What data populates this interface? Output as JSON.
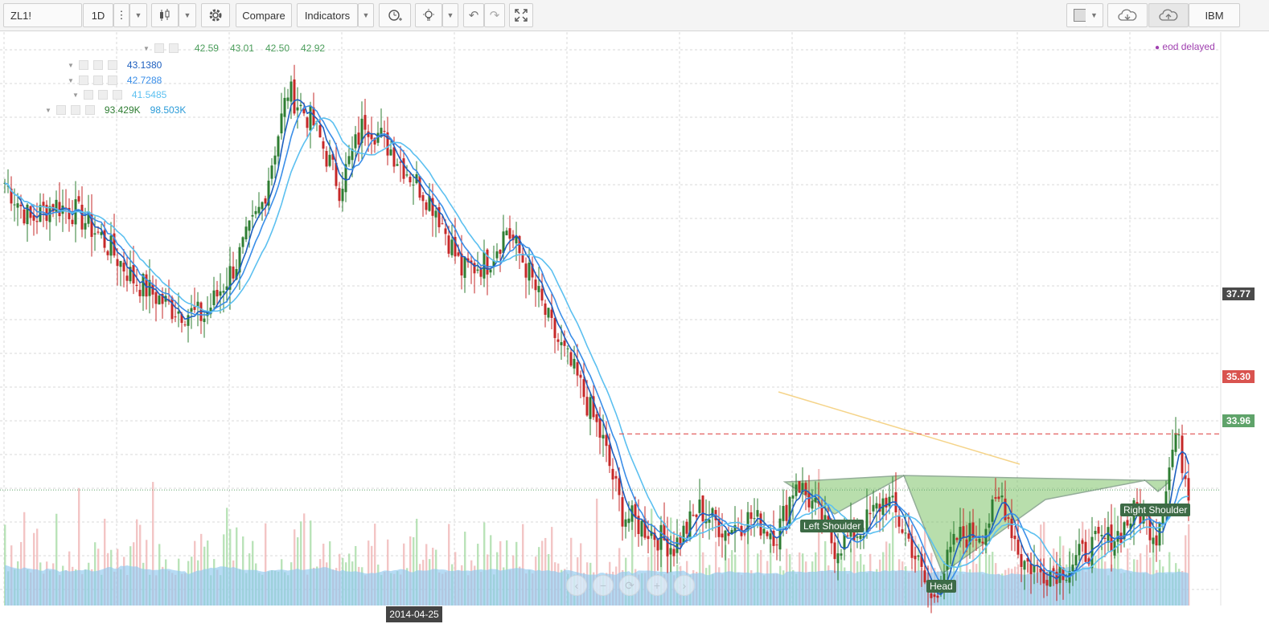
{
  "toolbar": {
    "symbol": "ZL1!",
    "interval": "1D",
    "compare_label": "Compare",
    "indicators_label": "Indicators",
    "account_label": "IBM",
    "icons": [
      "candles-icon",
      "gear-icon",
      "alarm-icon",
      "idea-bulb-icon",
      "undo-icon",
      "redo-icon",
      "fullscreen-icon",
      "color-swatch-icon",
      "cloud-load-icon",
      "cloud-save-icon"
    ]
  },
  "legend": {
    "ohlc": [
      "42.59",
      "43.01",
      "42.50",
      "42.92"
    ],
    "ma1": "43.1380",
    "ma2": "42.7288",
    "ma3": "41.5485",
    "volume": [
      "93.429K",
      "98.503K"
    ]
  },
  "eod_label": "eod delayed",
  "price_labels": {
    "p1": "37.77",
    "p2": "35.30",
    "p3": "33.96"
  },
  "date_label": "2014-04-25",
  "nav_buttons": [
    "‹",
    "−",
    "⟳",
    "+",
    "›"
  ],
  "annotations": {
    "left_shoulder": "Left Shoulder",
    "head": "Head",
    "right_shoulder": "Right Shoulder"
  },
  "colors": {
    "up": "#2e7d32",
    "down": "#c62828",
    "ma1": "#1e5fbf",
    "ma2": "#3a8ee8",
    "ma3": "#5cc0f0",
    "volume_area": "#8fc8ee",
    "pattern_fill": "#7fc46a",
    "resistance": "#e05050",
    "last_price": "#5fa36a"
  },
  "chart_data": {
    "type": "candlestick",
    "symbol": "ZL1!",
    "interval": "1D",
    "ylim": [
      31.2,
      44.9
    ],
    "close_keypoints": [
      [
        0,
        41.3
      ],
      [
        8,
        40.4
      ],
      [
        15,
        40.8
      ],
      [
        22,
        40.6
      ],
      [
        30,
        40.0
      ],
      [
        40,
        39.0
      ],
      [
        52,
        38.3
      ],
      [
        62,
        38.1
      ],
      [
        72,
        39.4
      ],
      [
        80,
        40.8
      ],
      [
        88,
        43.5
      ],
      [
        96,
        42.7
      ],
      [
        104,
        41.2
      ],
      [
        112,
        42.8
      ],
      [
        118,
        42.3
      ],
      [
        126,
        41.5
      ],
      [
        134,
        40.7
      ],
      [
        142,
        39.2
      ],
      [
        150,
        39.4
      ],
      [
        156,
        40.2
      ],
      [
        162,
        39.3
      ],
      [
        170,
        37.8
      ],
      [
        178,
        36.6
      ],
      [
        186,
        35.1
      ],
      [
        192,
        33.4
      ],
      [
        200,
        33.0
      ],
      [
        208,
        32.6
      ],
      [
        216,
        33.5
      ],
      [
        224,
        33.0
      ],
      [
        232,
        33.3
      ],
      [
        240,
        32.9
      ],
      [
        246,
        34.2
      ],
      [
        252,
        33.5
      ],
      [
        258,
        32.6
      ],
      [
        266,
        33.0
      ],
      [
        274,
        33.8
      ],
      [
        282,
        32.6
      ],
      [
        288,
        31.3
      ],
      [
        296,
        32.8
      ],
      [
        304,
        33.0
      ],
      [
        310,
        33.8
      ],
      [
        316,
        32.3
      ],
      [
        322,
        32.0
      ],
      [
        330,
        32.1
      ],
      [
        338,
        32.6
      ],
      [
        346,
        32.9
      ],
      [
        352,
        33.5
      ],
      [
        358,
        32.9
      ],
      [
        364,
        35.3
      ],
      [
        368,
        34.0
      ]
    ],
    "patterns": [
      {
        "type": "head-and-shoulders (inverse)",
        "labels": [
          "Left Shoulder",
          "Head",
          "Right Shoulder"
        ],
        "neckline": 33.96
      }
    ],
    "horizontal_levels": [
      35.3
    ],
    "current_price": 33.96
  }
}
